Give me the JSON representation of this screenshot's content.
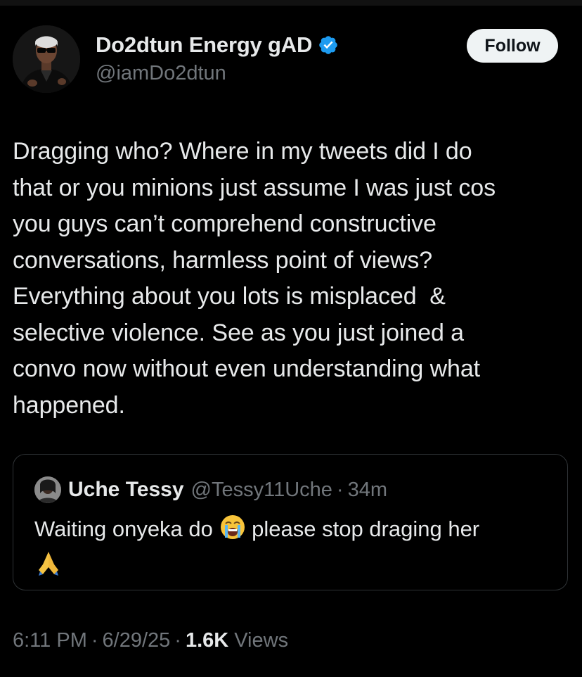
{
  "author": {
    "display_name": "Do2dtun Energy gAD",
    "handle": "@iamDo2dtun",
    "verified": true
  },
  "follow_label": "Follow",
  "tweet": {
    "lines": [
      "Dragging who? Where in my tweets did I do",
      "that or you minions just assume I was just cos",
      "you guys can’t comprehend constructive",
      "conversations, harmless point of views?",
      "Everything about you lots is misplaced  &",
      "selective violence. See as you just joined a",
      "convo now without even understanding what",
      "happened."
    ]
  },
  "quote": {
    "name": "Uche Tessy",
    "handle": "@Tessy11Uche",
    "separator": "·",
    "time": "34m",
    "text_before_emoji": "Waiting onyeka do ",
    "emoji_1": "loudly-crying-face-emoji",
    "text_after_emoji": " please stop draging her",
    "emoji_2": "folded-hands-emoji"
  },
  "meta": {
    "time": "6:11 PM",
    "date": "6/29/25",
    "views_count": "1.6K",
    "views_label": "Views",
    "separator": "·"
  },
  "colors": {
    "background": "#000000",
    "text": "#e7e9ea",
    "muted": "#71767b",
    "verified_blue": "#1d9bf0",
    "border": "#2f3336"
  }
}
